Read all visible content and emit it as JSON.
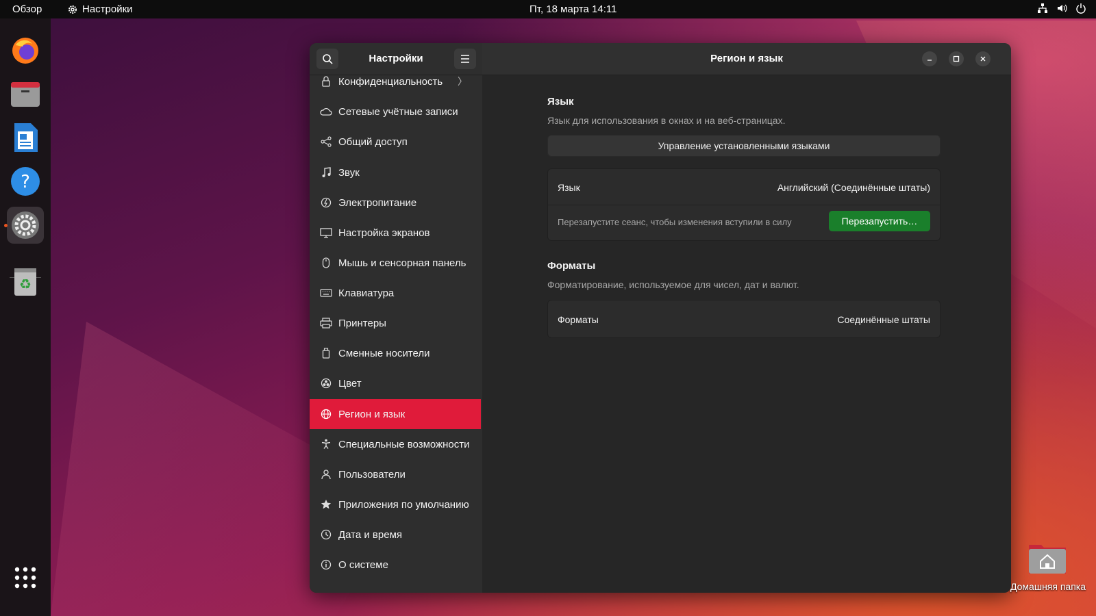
{
  "topbar": {
    "overview": "Обзор",
    "app_name": "Настройки",
    "clock": "Пт, 18 марта  14:11",
    "tray_icons": [
      "network-icon",
      "volume-icon",
      "power-icon"
    ]
  },
  "dock": {
    "apps": [
      "firefox-icon",
      "files-icon",
      "writer-icon",
      "help-icon",
      "settings-icon",
      "trash-icon"
    ],
    "show_apps": "app-grid-icon"
  },
  "window": {
    "sidebar_title": "Настройки",
    "title": "Регион и язык"
  },
  "sidebar": {
    "items": [
      {
        "label": "Конфиденциальность",
        "icon": "lock-icon",
        "has_chevron": true
      },
      {
        "label": "Сетевые учётные записи",
        "icon": "cloud-icon"
      },
      {
        "label": "Общий доступ",
        "icon": "share-icon"
      },
      {
        "label": "Звук",
        "icon": "music-note-icon"
      },
      {
        "label": "Электропитание",
        "icon": "power-icon"
      },
      {
        "label": "Настройка экранов",
        "icon": "display-icon"
      },
      {
        "label": "Мышь и сенсорная панель",
        "icon": "mouse-icon"
      },
      {
        "label": "Клавиатура",
        "icon": "keyboard-icon"
      },
      {
        "label": "Принтеры",
        "icon": "printer-icon"
      },
      {
        "label": "Сменные носители",
        "icon": "removable-media-icon"
      },
      {
        "label": "Цвет",
        "icon": "color-icon"
      },
      {
        "label": "Регион и язык",
        "icon": "globe-icon",
        "selected": true
      },
      {
        "label": "Специальные возможности",
        "icon": "accessibility-icon"
      },
      {
        "label": "Пользователи",
        "icon": "users-icon"
      },
      {
        "label": "Приложения по умолчанию",
        "icon": "star-icon"
      },
      {
        "label": "Дата и время",
        "icon": "clock-icon"
      },
      {
        "label": "О системе",
        "icon": "info-icon"
      }
    ],
    "chevron": "〉"
  },
  "content": {
    "language_section": {
      "title": "Язык",
      "subtitle": "Язык для использования в окнах и на веб-страницах.",
      "manage_button": "Управление установленными языками",
      "language_label": "Язык",
      "language_value": "Английский (Соединённые штаты)",
      "restart_note": "Перезапустите сеанс, чтобы изменения вступили в силу",
      "restart_button": "Перезапустить…"
    },
    "formats_section": {
      "title": "Форматы",
      "subtitle": "Форматирование, используемое для чисел, дат и валют.",
      "formats_label": "Форматы",
      "formats_value": "Соединённые штаты"
    }
  },
  "desktop": {
    "home_folder_label": "Домашняя папка"
  },
  "colors": {
    "accent_selected": "#e01b3a",
    "restart_button": "#1a7f2b",
    "window_bg": "#262626"
  }
}
